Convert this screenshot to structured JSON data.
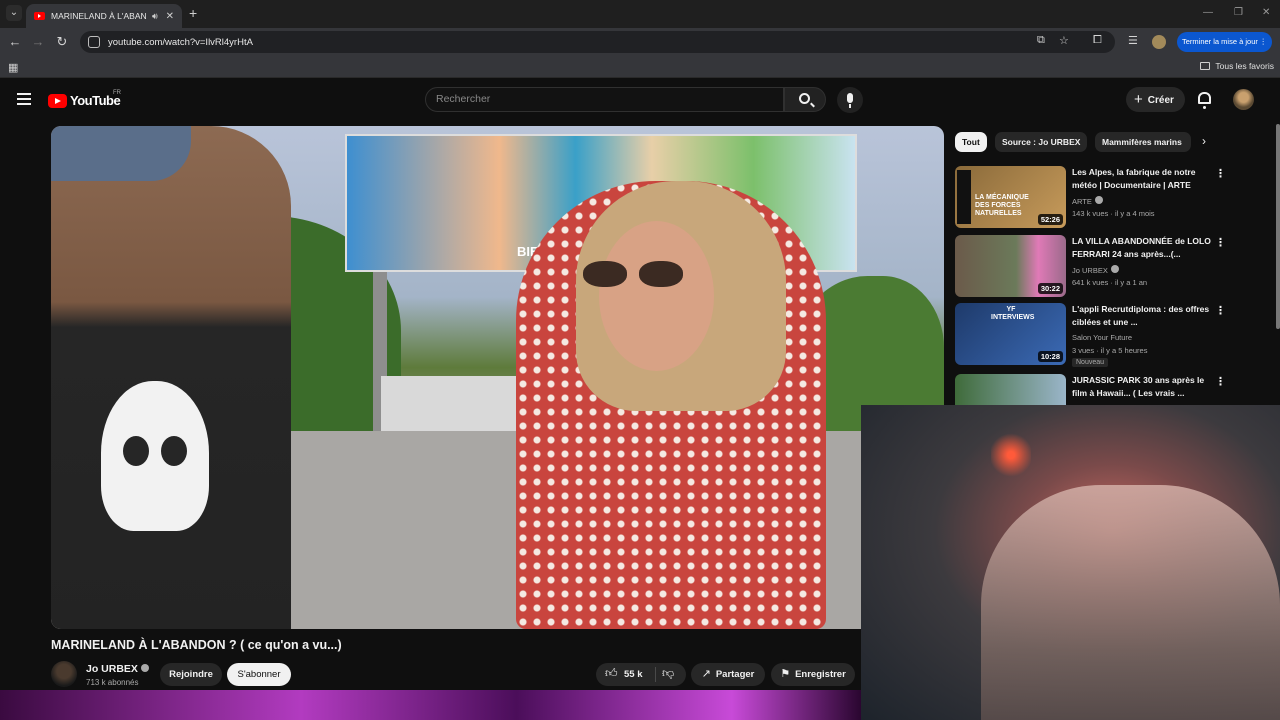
{
  "browser": {
    "tab_title": "MARINELAND À L'ABANDON ( ce qu'on a vu...) - YouTube",
    "url": "youtube.com/watch?v=IlvRl4yrHtA",
    "update_button": "Terminer la mise à jour",
    "bookmarks_folder": "Tous les favoris"
  },
  "header": {
    "logo_text": "YouTube",
    "country": "FR",
    "search_placeholder": "Rechercher",
    "create_label": "Créer"
  },
  "video": {
    "title": "MARINELAND À L'ABANDON ? ( ce qu'on a vu...)",
    "billboard_text": "BIENVENUE",
    "channel_name": "Jo URBEX",
    "subscribers": "713 k abonnés",
    "join_label": "Rejoindre",
    "subscribe_label": "S'abonner",
    "likes": "55 k",
    "share_label": "Partager",
    "save_label": "Enregistrer"
  },
  "chips": [
    "Tout",
    "Source : Jo URBEX",
    "Mammifères marins"
  ],
  "recommendations": [
    {
      "title": "Les Alpes, la fabrique de notre météo | Documentaire | ARTE",
      "channel": "ARTE",
      "meta": "143 k vues · il y a 4 mois",
      "duration": "52:26",
      "thumb_text": "LA MÉCANIQUE DES FORCES NATURELLES",
      "thumb_colors": [
        "#8a6a3a",
        "#c79b5b"
      ]
    },
    {
      "title": "LA VILLA ABANDONNÉE de LOLO FERRARI 24 ans après...(...",
      "channel": "Jo URBEX",
      "meta": "641 k vues · il y a 1 an",
      "duration": "30:22",
      "thumb_colors": [
        "#6b7a5a",
        "#e07ab7"
      ]
    },
    {
      "title": "L'appli Recrutdiploma : des offres ciblées et une ...",
      "channel": "Salon Your Future",
      "meta": "3 vues · il y a 5 heures",
      "duration": "10:28",
      "badge": "Nouveau",
      "thumb_text": "YF INTERVIEWS",
      "thumb_colors": [
        "#1e3a6a",
        "#3b6ab5"
      ]
    },
    {
      "title": "JURASSIC PARK 30 ans après le film à Hawaii... ( Les vrais ...",
      "channel": "",
      "meta": "",
      "duration": "",
      "thumb_colors": [
        "#3f6b3a",
        "#9ab5c9"
      ]
    }
  ]
}
